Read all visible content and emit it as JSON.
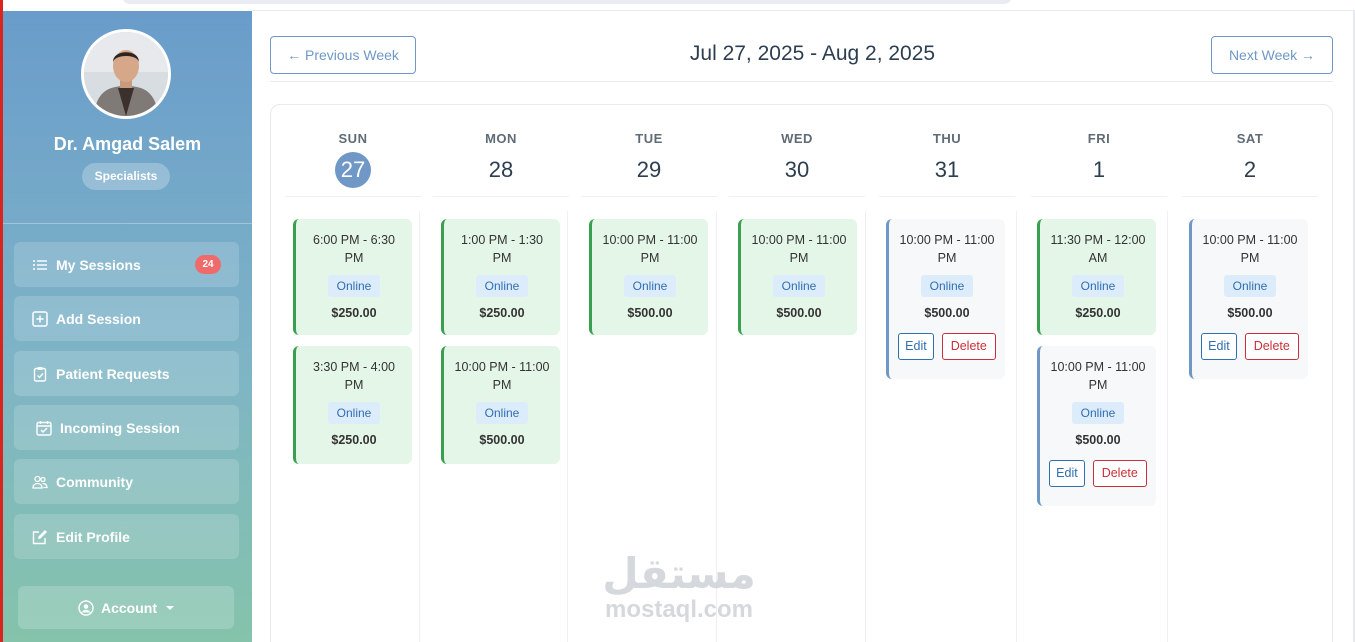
{
  "profile": {
    "name": "Dr. Amgad Salem",
    "role": "Specialists"
  },
  "nav": {
    "items": [
      {
        "label": "My Sessions",
        "icon": "list-icon",
        "count": "24"
      },
      {
        "label": "Add Session",
        "icon": "plus-square-icon"
      },
      {
        "label": "Patient Requests",
        "icon": "clipboard-check-icon"
      },
      {
        "label": "Incoming Session",
        "icon": "calendar-check-icon"
      },
      {
        "label": "Community",
        "icon": "people-icon"
      },
      {
        "label": "Edit Profile",
        "icon": "edit-icon"
      }
    ],
    "account_label": "Account"
  },
  "week": {
    "prev_label": "← Previous Week",
    "next_label": "Next Week →",
    "range": "Jul 27, 2025 - Aug 2, 2025"
  },
  "days": [
    {
      "name": "SUN",
      "num": "27",
      "today": true
    },
    {
      "name": "MON",
      "num": "28"
    },
    {
      "name": "TUE",
      "num": "29"
    },
    {
      "name": "WED",
      "num": "30"
    },
    {
      "name": "THU",
      "num": "31"
    },
    {
      "name": "FRI",
      "num": "1"
    },
    {
      "name": "SAT",
      "num": "2"
    }
  ],
  "sessions": {
    "sun": [
      {
        "time": "6:00 PM - 6:30 PM",
        "mode": "Online",
        "price": "$250.00"
      },
      {
        "time": "3:30 PM - 4:00 PM",
        "mode": "Online",
        "price": "$250.00"
      }
    ],
    "mon": [
      {
        "time": "1:00 PM - 1:30 PM",
        "mode": "Online",
        "price": "$250.00"
      },
      {
        "time": "10:00 PM - 11:00 PM",
        "mode": "Online",
        "price": "$500.00"
      }
    ],
    "tue": [
      {
        "time": "10:00 PM - 11:00 PM",
        "mode": "Online",
        "price": "$500.00"
      }
    ],
    "wed": [
      {
        "time": "10:00 PM - 11:00 PM",
        "mode": "Online",
        "price": "$500.00"
      }
    ],
    "thu": [
      {
        "time": "10:00 PM - 11:00 PM",
        "mode": "Online",
        "price": "$500.00",
        "edit": "Edit",
        "delete": "Delete"
      }
    ],
    "fri": [
      {
        "time": "11:30 PM - 12:00 AM",
        "mode": "Online",
        "price": "$250.00"
      },
      {
        "time": "10:00 PM - 11:00 PM",
        "mode": "Online",
        "price": "$500.00",
        "edit": "Edit",
        "delete": "Delete"
      }
    ],
    "sat": [
      {
        "time": "10:00 PM - 11:00 PM",
        "mode": "Online",
        "price": "$500.00",
        "edit": "Edit",
        "delete": "Delete"
      }
    ]
  },
  "watermark": {
    "arabic": "مستقل",
    "latin": "mostaql.com"
  },
  "colors": {
    "accent": "#6f98c6",
    "booked_border": "#3aa050",
    "booked_bg": "#e4f6e7",
    "danger": "#c9303a",
    "badge": "#ef6b6b"
  }
}
